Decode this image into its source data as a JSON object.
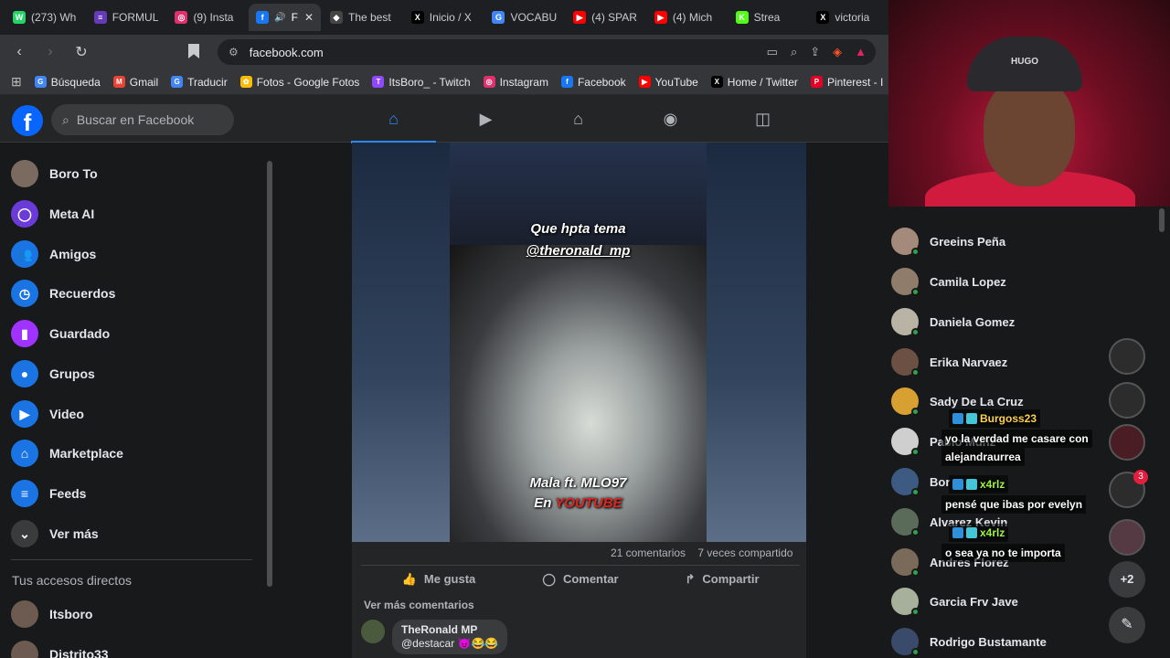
{
  "browser": {
    "tabs": [
      {
        "label": "(273) Wh",
        "color": "#25d366",
        "glyph": "W"
      },
      {
        "label": "FORMUL",
        "color": "#673ab7",
        "glyph": "≡"
      },
      {
        "label": "(9) Insta",
        "color": "#e1306c",
        "glyph": "◎"
      },
      {
        "label": "F",
        "color": "#1877f2",
        "glyph": "f",
        "active": true
      },
      {
        "label": "The best",
        "color": "#444",
        "glyph": "◆"
      },
      {
        "label": "Inicio / X",
        "color": "#000",
        "glyph": "X"
      },
      {
        "label": "VOCABU",
        "color": "#4285f4",
        "glyph": "G"
      },
      {
        "label": "(4) SPAR",
        "color": "#ff0000",
        "glyph": "▶"
      },
      {
        "label": "(4) Mich",
        "color": "#ff0000",
        "glyph": "▶"
      },
      {
        "label": "Strea",
        "color": "#53fc18",
        "glyph": "K"
      },
      {
        "label": "victoria",
        "color": "#000",
        "glyph": "X"
      }
    ],
    "url": "facebook.com",
    "bookmarks": [
      {
        "label": "Búsqueda",
        "color": "#4285f4",
        "glyph": "G"
      },
      {
        "label": "Gmail",
        "color": "#ea4335",
        "glyph": "M"
      },
      {
        "label": "Traducir",
        "color": "#4285f4",
        "glyph": "G"
      },
      {
        "label": "Fotos - Google Fotos",
        "color": "#fbbc05",
        "glyph": "✿"
      },
      {
        "label": "ItsBoro_ - Twitch",
        "color": "#9146ff",
        "glyph": "T"
      },
      {
        "label": "Instagram",
        "color": "#e1306c",
        "glyph": "◎"
      },
      {
        "label": "Facebook",
        "color": "#1877f2",
        "glyph": "f"
      },
      {
        "label": "YouTube",
        "color": "#ff0000",
        "glyph": "▶"
      },
      {
        "label": "Home / Twitter",
        "color": "#000",
        "glyph": "X"
      },
      {
        "label": "Pinterest - I",
        "color": "#e60023",
        "glyph": "P"
      }
    ]
  },
  "facebook": {
    "search_placeholder": "Buscar en Facebook",
    "sidebar": [
      {
        "label": "Boro To",
        "color": "#7a6a60",
        "glyph": ""
      },
      {
        "label": "Meta AI",
        "color": "#6a3bd8",
        "glyph": "◯"
      },
      {
        "label": "Amigos",
        "color": "#1b74e4",
        "glyph": "👥"
      },
      {
        "label": "Recuerdos",
        "color": "#1b74e4",
        "glyph": "◷"
      },
      {
        "label": "Guardado",
        "color": "#a033ff",
        "glyph": "▮"
      },
      {
        "label": "Grupos",
        "color": "#1b74e4",
        "glyph": "●"
      },
      {
        "label": "Video",
        "color": "#1b74e4",
        "glyph": "▶"
      },
      {
        "label": "Marketplace",
        "color": "#1b74e4",
        "glyph": "⌂"
      },
      {
        "label": "Feeds",
        "color": "#1b74e4",
        "glyph": "≡"
      },
      {
        "label": "Ver más",
        "color": "#3a3b3c",
        "glyph": "⌄"
      }
    ],
    "shortcuts_heading": "Tus accesos directos",
    "shortcuts": [
      {
        "label": "Itsboro"
      },
      {
        "label": "Distrito33"
      }
    ],
    "post": {
      "caption_top_1": "Que hpta tema",
      "caption_top_2": "@theronald_mp",
      "caption_bottom_1": "Mala ft. MLO97",
      "caption_bottom_2a": "En ",
      "caption_bottom_2b": "YOUTUBE",
      "stats_comments": "21 comentarios",
      "stats_shares": "7 veces compartido",
      "like_label": "Me gusta",
      "comment_label": "Comentar",
      "share_label": "Compartir",
      "more_comments": "Ver más comentarios",
      "comment_author": "TheRonald MP",
      "comment_text": "@destacar 😈😂😂"
    }
  },
  "contacts": [
    {
      "name": "Greeins Peña",
      "color": "#a48a7a"
    },
    {
      "name": "Camila Lopez",
      "color": "#8f7c6b"
    },
    {
      "name": "Daniela Gomez",
      "color": "#b9b3a6"
    },
    {
      "name": "Erika Narvaez",
      "color": "#6b5043"
    },
    {
      "name": "Sady De La Cruz",
      "color": "#d8a030"
    },
    {
      "name": "Pablo Mdhz",
      "color": "#cfcfcf"
    },
    {
      "name": "Bor",
      "color": "#3d5b82"
    },
    {
      "name": "Alvarez Kevin",
      "color": "#5a6b5a"
    },
    {
      "name": "Andres Florez",
      "color": "#7a6a5a"
    },
    {
      "name": "Garcia Frv Jave",
      "color": "#a6b09a"
    },
    {
      "name": "Rodrigo Bustamante",
      "color": "#3a4a6a"
    }
  ],
  "chat_badge_count": "3",
  "more_chats": "+2",
  "webcam_cap_text": "HUGO",
  "chat": [
    {
      "user": "Burgoss23",
      "message_1": "yo la verdad me casare con",
      "message_2": "alejandraurrea"
    },
    {
      "user": "x4rlz",
      "message_1": "pensé que ibas por evelyn"
    },
    {
      "user": "x4rlz",
      "message_1": "o sea ya no te importa"
    }
  ]
}
